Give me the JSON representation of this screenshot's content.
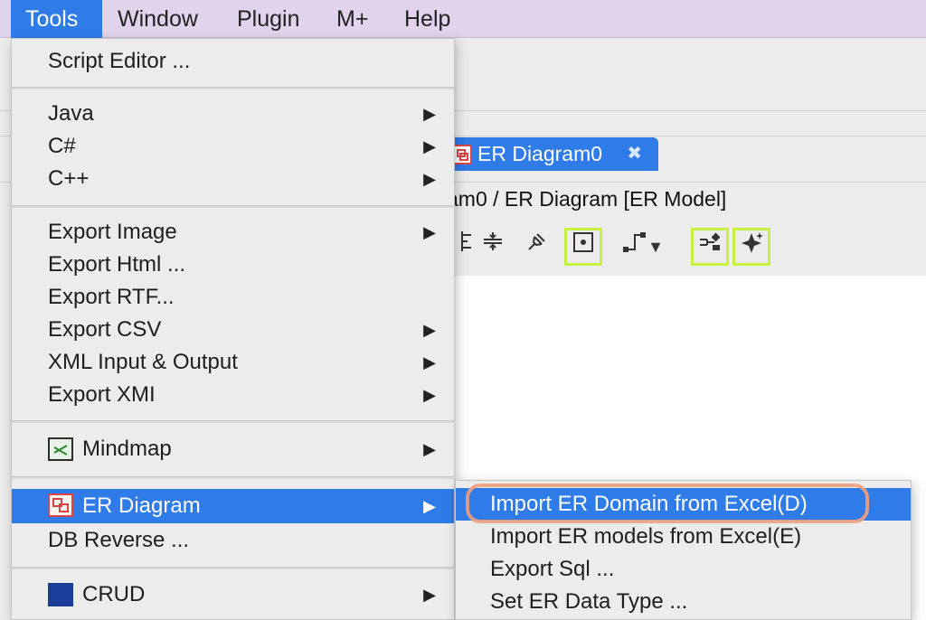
{
  "menubar": {
    "items": [
      "Tools",
      "Window",
      "Plugin",
      "M+",
      "Help"
    ],
    "active": "Tools"
  },
  "editor": {
    "tab_label": "ER Diagram0",
    "tab_close": "✖",
    "breadcrumb": "am0 / ER Diagram [ER Model]"
  },
  "toolbar": {
    "icons": [
      "align-icon",
      "distribute-icon",
      "pin-icon",
      "center-icon",
      "connector-icon",
      "dropdown-icon",
      "arrange-icon",
      "sparkle-icon"
    ]
  },
  "tools_menu": {
    "items": [
      {
        "label": "Script Editor ...",
        "submenu": false
      },
      {
        "label": "Java",
        "submenu": true
      },
      {
        "label": "C#",
        "submenu": true
      },
      {
        "label": "C++",
        "submenu": true
      },
      {
        "label": "Export Image",
        "submenu": true
      },
      {
        "label": "Export Html ...",
        "submenu": false
      },
      {
        "label": "Export RTF...",
        "submenu": false
      },
      {
        "label": "Export CSV",
        "submenu": true
      },
      {
        "label": "XML Input & Output",
        "submenu": true
      },
      {
        "label": "Export XMI",
        "submenu": true
      },
      {
        "label": "Mindmap",
        "submenu": true,
        "icon": "mindmap-icon"
      },
      {
        "label": "ER Diagram",
        "submenu": true,
        "icon": "er-diagram-icon",
        "selected": true
      },
      {
        "label": "DB Reverse ...",
        "submenu": false
      },
      {
        "label": "CRUD",
        "submenu": true,
        "icon": "crud-icon"
      }
    ],
    "arrow": "▶"
  },
  "er_submenu": {
    "items": [
      {
        "label": "Import ER Domain from Excel(D)",
        "selected": true
      },
      {
        "label": "Import ER models from Excel(E)"
      },
      {
        "label": "Export Sql ..."
      },
      {
        "label": "Set ER Data Type ..."
      }
    ]
  },
  "colors": {
    "menubar_bg": "#e0d4ec",
    "selection": "#2f7be8",
    "highlight_outline": "#c8f040",
    "callout": "#f0a080"
  }
}
